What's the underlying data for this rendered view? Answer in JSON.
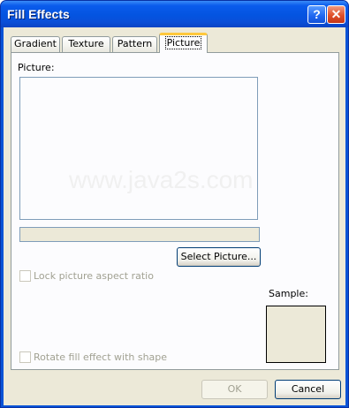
{
  "window": {
    "title": "Fill Effects"
  },
  "titlebar_buttons": {
    "help": "?",
    "close": "✕"
  },
  "tabs": [
    {
      "label": "Gradient"
    },
    {
      "label": "Texture"
    },
    {
      "label": "Pattern"
    },
    {
      "label": "Picture"
    }
  ],
  "picture_tab": {
    "picture_label": "Picture:",
    "select_button": "Select Picture...",
    "lock_checkbox": {
      "label": "Lock picture aspect ratio",
      "checked": false,
      "enabled": false
    },
    "rotate_checkbox": {
      "label": "Rotate fill effect with shape",
      "checked": false,
      "enabled": false
    },
    "sample_label": "Sample:",
    "watermark": "www.java2s.com"
  },
  "footer": {
    "ok": "OK",
    "cancel": "Cancel"
  },
  "colors": {
    "titlebar": "#0a5bec",
    "client": "#ece9d8",
    "active_tab_highlight": "#ffc83c"
  }
}
